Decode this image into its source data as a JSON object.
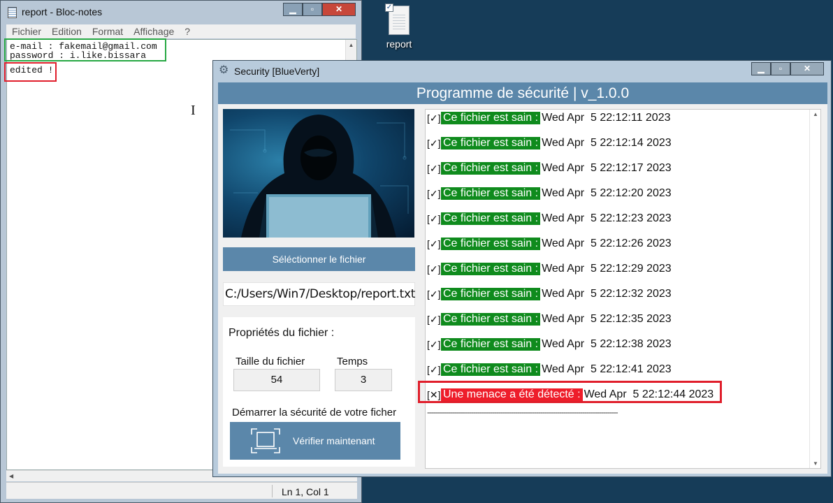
{
  "desktop": {
    "icon_label": "report",
    "icon_name": "text-file-icon"
  },
  "notepad": {
    "title": "report - Bloc-notes",
    "menu": [
      "Fichier",
      "Edition",
      "Format",
      "Affichage",
      "?"
    ],
    "lines": [
      "e-mail : fakemail@gmail.com",
      "password : i.like.bissara",
      "",
      "edited !"
    ],
    "status_position": "Ln 1, Col 1",
    "highlight_colors": {
      "credentials": "#26a843",
      "edited": "#e01e2b"
    }
  },
  "security": {
    "title": "Security [BlueVerty]",
    "header": "Programme de sécurité | v_1.0.0",
    "select_button": "Séléctionner le fichier",
    "file_path": "C:/Users/Win7/Desktop/report.txt",
    "props_title": "Propriétés du fichier :",
    "size_label": "Taille du fichier",
    "size_value": "54",
    "time_label": "Temps",
    "time_value": "3",
    "start_label": "Démarrer la sécurité de votre ficher",
    "verify_button": "Vérifier maintenant",
    "accent_color": "#5b87aa",
    "log": [
      {
        "status": "ok",
        "icon": "[✓]>",
        "message": "Ce fichier est sain :",
        "time": "Wed Apr  5 22:12:11 2023"
      },
      {
        "status": "ok",
        "icon": "[✓]>",
        "message": "Ce fichier est sain :",
        "time": "Wed Apr  5 22:12:14 2023"
      },
      {
        "status": "ok",
        "icon": "[✓]>",
        "message": "Ce fichier est sain :",
        "time": "Wed Apr  5 22:12:17 2023"
      },
      {
        "status": "ok",
        "icon": "[✓]>",
        "message": "Ce fichier est sain :",
        "time": "Wed Apr  5 22:12:20 2023"
      },
      {
        "status": "ok",
        "icon": "[✓]>",
        "message": "Ce fichier est sain :",
        "time": "Wed Apr  5 22:12:23 2023"
      },
      {
        "status": "ok",
        "icon": "[✓]>",
        "message": "Ce fichier est sain :",
        "time": "Wed Apr  5 22:12:26 2023"
      },
      {
        "status": "ok",
        "icon": "[✓]>",
        "message": "Ce fichier est sain :",
        "time": "Wed Apr  5 22:12:29 2023"
      },
      {
        "status": "ok",
        "icon": "[✓]>",
        "message": "Ce fichier est sain :",
        "time": "Wed Apr  5 22:12:32 2023"
      },
      {
        "status": "ok",
        "icon": "[✓]>",
        "message": "Ce fichier est sain :",
        "time": "Wed Apr  5 22:12:35 2023"
      },
      {
        "status": "ok",
        "icon": "[✓]>",
        "message": "Ce fichier est sain :",
        "time": "Wed Apr  5 22:12:38 2023"
      },
      {
        "status": "ok",
        "icon": "[✓]>",
        "message": "Ce fichier est sain :",
        "time": "Wed Apr  5 22:12:41 2023"
      },
      {
        "status": "threat",
        "icon": "[✕]>",
        "message": "Une menace a été détecté :",
        "time": "Wed Apr  5 22:12:44 2023"
      }
    ],
    "separator": "-------------------------------------------------------------------------------------------",
    "status_colors": {
      "ok": "#0f8b1d",
      "threat": "#ee1d2a"
    }
  }
}
